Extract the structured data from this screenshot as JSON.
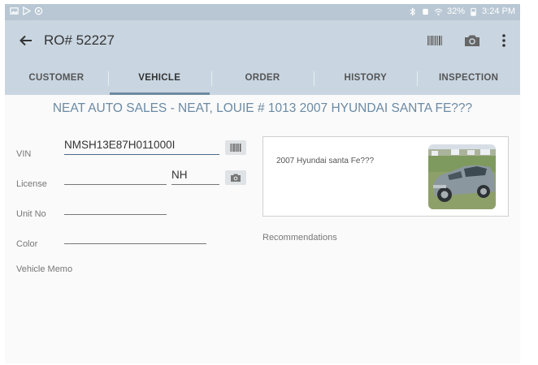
{
  "status_bar": {
    "time": "3:24 PM",
    "battery": "32%"
  },
  "toolbar": {
    "title": "RO# 52227",
    "barcode_icon": "barcode-icon",
    "camera_icon": "camera-icon",
    "menu_icon": "more-vert-icon"
  },
  "tabs": [
    {
      "label": "CUSTOMER"
    },
    {
      "label": "VEHICLE"
    },
    {
      "label": "ORDER"
    },
    {
      "label": "HISTORY"
    },
    {
      "label": "INSPECTION"
    }
  ],
  "active_tab": "VEHICLE",
  "heading": "NEAT AUTO SALES - NEAT, LOUIE # 1013    2007 HYUNDAI SANTA FE???",
  "form": {
    "vin_label": "VIN",
    "vin_value": "NMSH13E87H011000I",
    "license_label": "License",
    "license_value": "",
    "state_value": "NH",
    "unit_label": "Unit No",
    "unit_value": "",
    "color_label": "Color",
    "color_value": "",
    "memo_label": "Vehicle Memo"
  },
  "vehicle_card": {
    "description": "2007 Hyundai santa Fe???"
  },
  "recommendations_label": "Recommendations",
  "colors": {
    "toolbar": "#c9d6e1",
    "status_bar": "#b8c7d3",
    "heading": "#6b8aa4",
    "tab_indicator": "#6e8aa1"
  }
}
